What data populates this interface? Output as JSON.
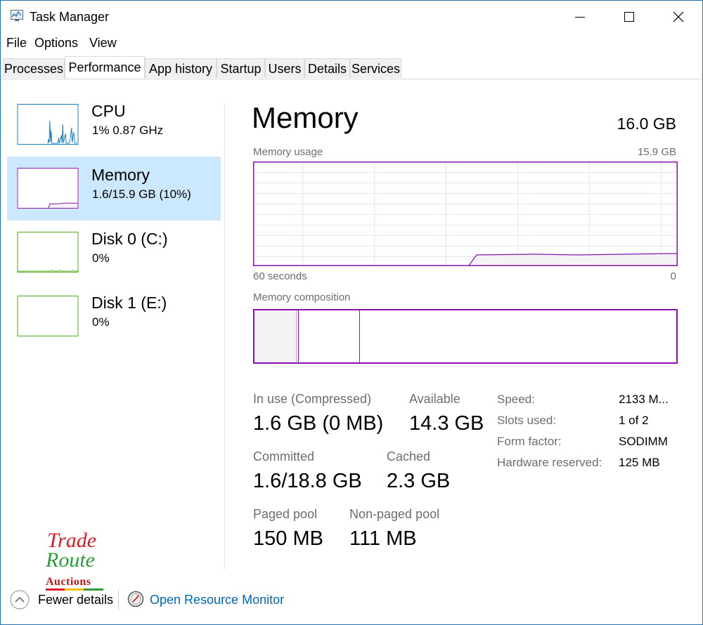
{
  "window": {
    "title": "Task Manager"
  },
  "menu": {
    "file": "File",
    "options": "Options",
    "view": "View"
  },
  "tabs": [
    "Processes",
    "Performance",
    "App history",
    "Startup",
    "Users",
    "Details",
    "Services"
  ],
  "active_tab": "Performance",
  "sidebar": {
    "items": [
      {
        "title": "CPU",
        "subtitle": "1%  0.87 GHz",
        "color": "#117dbb"
      },
      {
        "title": "Memory",
        "subtitle": "1.6/15.9 GB (10%)",
        "color": "#8b12ae"
      },
      {
        "title": "Disk 0 (C:)",
        "subtitle": "0%",
        "color": "#4da60c"
      },
      {
        "title": "Disk 1 (E:)",
        "subtitle": "0%",
        "color": "#4da60c"
      }
    ]
  },
  "main": {
    "heading": "Memory",
    "total": "16.0 GB",
    "usage_graph": {
      "label": "Memory usage",
      "max_label": "15.9 GB",
      "time_label": "60 seconds",
      "end_label": "0",
      "usage_percent": 10
    },
    "composition": {
      "label": "Memory composition"
    },
    "stats": {
      "in_use_label": "In use (Compressed)",
      "in_use_value": "1.6 GB (0 MB)",
      "available_label": "Available",
      "available_value": "14.3 GB",
      "committed_label": "Committed",
      "committed_value": "1.6/18.8 GB",
      "cached_label": "Cached",
      "cached_value": "2.3 GB",
      "paged_label": "Paged pool",
      "paged_value": "150 MB",
      "nonpaged_label": "Non-paged pool",
      "nonpaged_value": "111 MB"
    },
    "properties": [
      {
        "label": "Speed:",
        "value": "2133 M..."
      },
      {
        "label": "Slots used:",
        "value": "1 of 2"
      },
      {
        "label": "Form factor:",
        "value": "SODIMM"
      },
      {
        "label": "Hardware reserved:",
        "value": "125 MB"
      }
    ]
  },
  "footer": {
    "fewer_details": "Fewer details",
    "open_resource_monitor": "Open Resource Monitor"
  },
  "watermark": {
    "line1": "Trade",
    "line2": "Route",
    "line3": "Auctions"
  },
  "colors": {
    "memory": "#8b12ae",
    "cpu": "#117dbb",
    "disk": "#4da60c",
    "selection": "#cce8ff",
    "link": "#0066b4"
  }
}
